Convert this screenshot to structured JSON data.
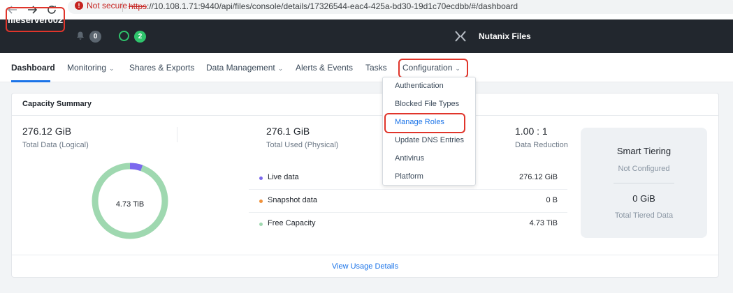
{
  "browser": {
    "security_text": "Not secure",
    "url_protocol": "https",
    "url_rest": "://10.108.1.71:9440/api/files/console/details/17326544-eac4-425a-bd30-19d1c70ecdbb/#/dashboard"
  },
  "header": {
    "server_name": "fileserver002",
    "alert_count": "0",
    "task_count": "2",
    "product_name": "Nutanix Files"
  },
  "tabs": [
    {
      "label": "Dashboard",
      "active": true
    },
    {
      "label": "Monitoring",
      "has_caret": true
    },
    {
      "label": "Shares & Exports"
    },
    {
      "label": "Data Management",
      "has_caret": true
    },
    {
      "label": "Alerts & Events"
    },
    {
      "label": "Tasks"
    },
    {
      "label": "Configuration",
      "has_caret": true
    }
  ],
  "config_menu": {
    "items": [
      "Authentication",
      "Blocked File Types",
      "Manage Roles",
      "Update DNS Entries",
      "Antivirus",
      "Platform"
    ],
    "selected": "Manage Roles"
  },
  "capacity": {
    "title": "Capacity Summary",
    "stats": [
      {
        "value": "276.12 GiB",
        "label": "Total Data (Logical)"
      },
      {
        "value": "276.1 GiB",
        "label": "Total Used (Physical)"
      },
      {
        "value": "1.00 : 1",
        "label": "Data Reduction"
      }
    ],
    "donut_label": "4.73 TiB",
    "legend": [
      {
        "name": "Live data",
        "value": "276.12 GiB",
        "color": "#7b68ee"
      },
      {
        "name": "Snapshot data",
        "value": "0 B",
        "color": "#f0913a"
      },
      {
        "name": "Free Capacity",
        "value": "4.73 TiB",
        "color": "#9fd8b0"
      }
    ],
    "view_details": "View Usage Details"
  },
  "tiering": {
    "title": "Smart Tiering",
    "status": "Not Configured",
    "value": "0 GiB",
    "label": "Total Tiered Data"
  },
  "colors": {
    "header_bg": "#22272e",
    "accent": "#1a73e8",
    "highlight": "#e0352b",
    "free_capacity": "#9fd8b0",
    "live_data": "#7b68ee"
  }
}
